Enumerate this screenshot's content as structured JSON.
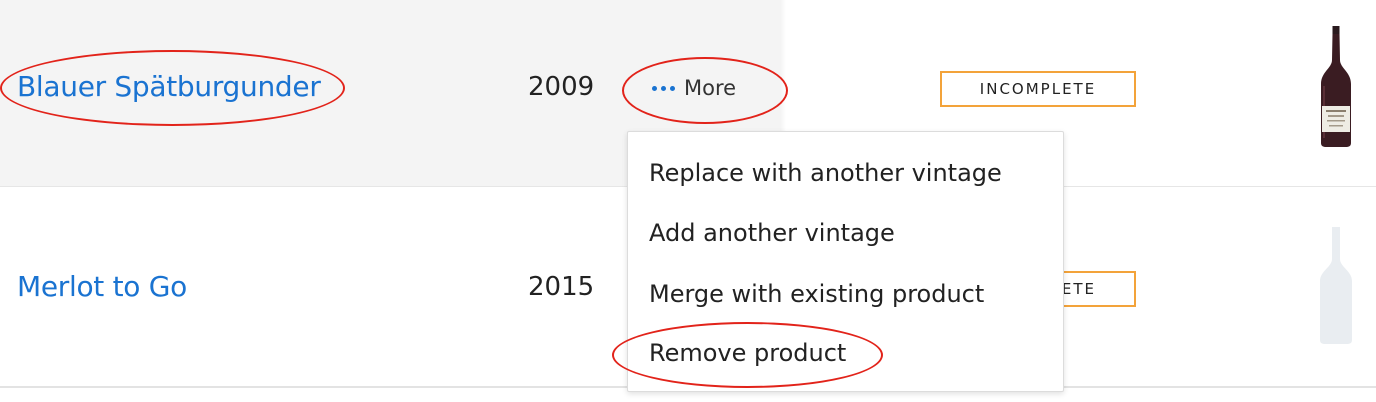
{
  "rows": [
    {
      "name": "Blauer Spätburgunder",
      "vintage": "2009",
      "more_label": "More",
      "status": "INCOMPLETE",
      "bottle_image": "red-wine-bottle"
    },
    {
      "name": "Merlot to Go",
      "vintage": "2015",
      "status_partial": "ETE",
      "bottle_image": "placeholder-bottle-icon"
    }
  ],
  "dropdown": {
    "items": [
      "Replace with another vintage",
      "Add another vintage",
      "Merge with existing product",
      "Remove product"
    ]
  },
  "colors": {
    "link": "#1a73d1",
    "badge_border": "#f3a33a",
    "annotation": "#e2231a",
    "row_highlight": "#f4f4f4"
  }
}
